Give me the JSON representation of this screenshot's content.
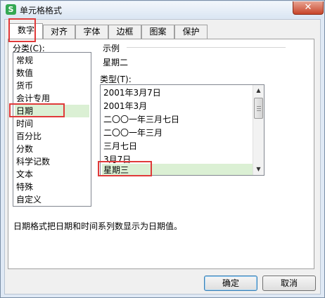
{
  "window": {
    "title": "单元格格式",
    "app_icon_glyph": "S",
    "close_glyph": "✕"
  },
  "tabs": [
    {
      "label": "数字",
      "active": true
    },
    {
      "label": "对齐",
      "active": false
    },
    {
      "label": "字体",
      "active": false
    },
    {
      "label": "边框",
      "active": false
    },
    {
      "label": "图案",
      "active": false
    },
    {
      "label": "保护",
      "active": false
    }
  ],
  "category": {
    "label": "分类(C):",
    "items": [
      "常规",
      "数值",
      "货币",
      "会计专用",
      "日期",
      "时间",
      "百分比",
      "分数",
      "科学记数",
      "文本",
      "特殊",
      "自定义"
    ],
    "selected": "日期"
  },
  "sample": {
    "label": "示例",
    "value": "星期二"
  },
  "type": {
    "label": "类型(T):",
    "items": [
      "2001年3月7日",
      "2001年3月",
      "二〇〇一年三月七日",
      "二〇〇一年三月",
      "三月七日",
      "3月7日",
      "星期三"
    ],
    "selected": "星期三"
  },
  "description": "日期格式把日期和时间系列数显示为日期值。",
  "buttons": {
    "ok": "确定",
    "cancel": "取消"
  },
  "colors": {
    "highlight_box": "#e03a3a",
    "selection": "#dbf0d4",
    "app_icon": "#34a853"
  },
  "icons": {
    "scroll_up": "▲",
    "scroll_down": "▼"
  }
}
